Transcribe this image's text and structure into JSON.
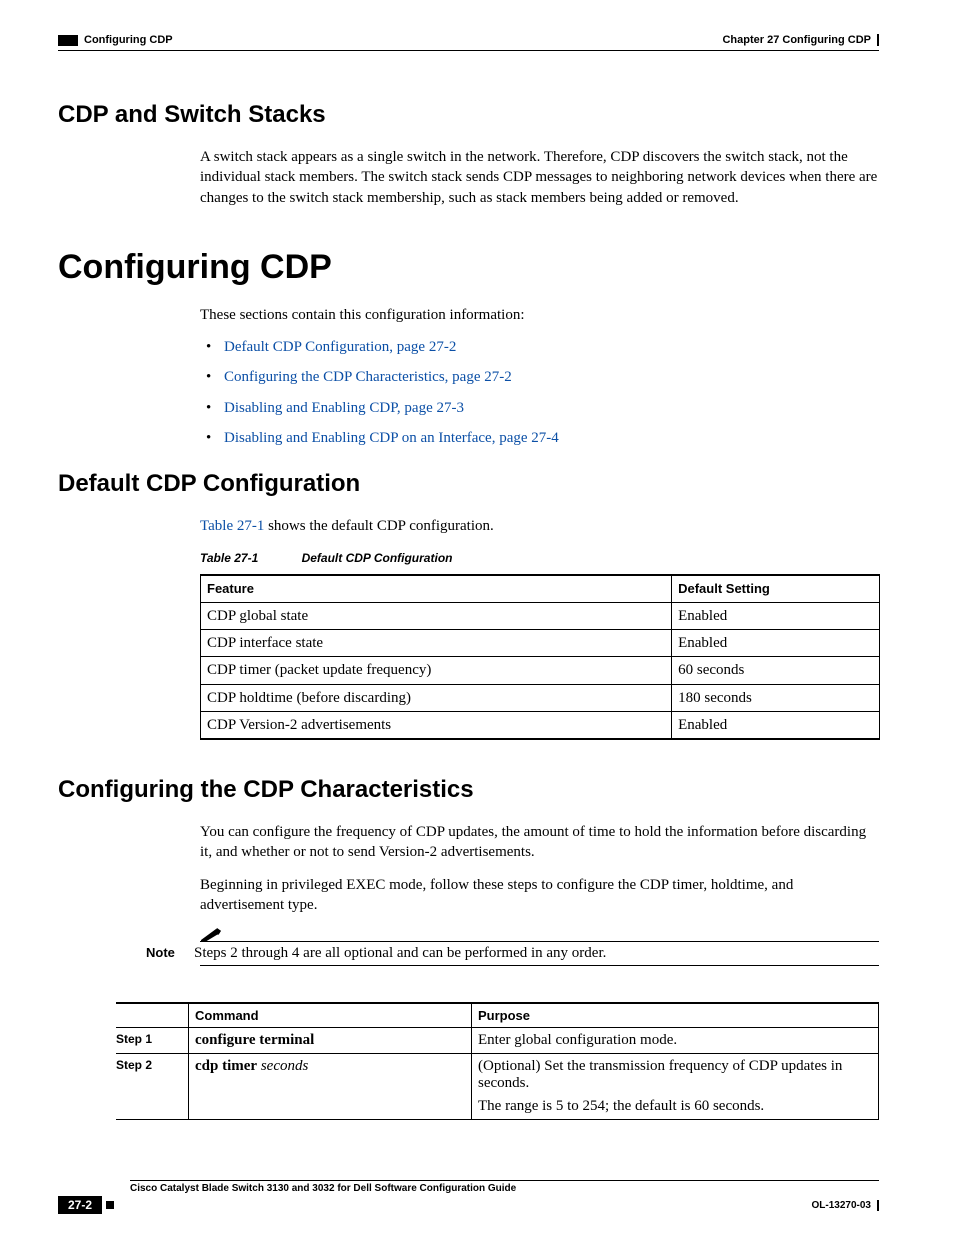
{
  "header": {
    "chapter_label": "Chapter 27    Configuring CDP",
    "section_label": "Configuring CDP"
  },
  "section1": {
    "title": "CDP and Switch Stacks",
    "body": "A switch stack appears as a single switch in the network. Therefore, CDP discovers the switch stack, not the individual stack members. The switch stack sends CDP messages to neighboring network devices when there are changes to the switch stack membership, such as stack members being added or removed."
  },
  "main_heading": "Configuring CDP",
  "intro_p": "These sections contain this configuration information:",
  "links": [
    "Default CDP Configuration, page 27-2",
    "Configuring the CDP Characteristics, page 27-2",
    "Disabling and Enabling CDP, page 27-3",
    "Disabling and Enabling CDP on an Interface, page 27-4"
  ],
  "section2": {
    "title": "Default CDP Configuration",
    "intro_prefix_link": "Table 27-1",
    "intro_suffix": " shows the default CDP configuration.",
    "table_caption_label": "Table 27-1",
    "table_caption_title": "Default CDP Configuration",
    "table_headers": [
      "Feature",
      "Default Setting"
    ],
    "table_rows": [
      [
        "CDP global state",
        "Enabled"
      ],
      [
        "CDP interface state",
        "Enabled"
      ],
      [
        "CDP timer (packet update frequency)",
        "60 seconds"
      ],
      [
        "CDP holdtime (before discarding)",
        "180 seconds"
      ],
      [
        "CDP Version-2 advertisements",
        "Enabled"
      ]
    ]
  },
  "section3": {
    "title": "Configuring the CDP Characteristics",
    "p1": "You can configure the frequency of CDP updates, the amount of time to hold the information before discarding it, and whether or not to send Version-2 advertisements.",
    "p2": "Beginning in privileged EXEC mode, follow these steps to configure the CDP timer, holdtime, and advertisement type.",
    "note_label": "Note",
    "note_text": "Steps 2 through 4 are all optional and can be performed in any order.",
    "cmd_headers": [
      "",
      "Command",
      "Purpose"
    ],
    "cmd_rows": [
      {
        "step": "Step 1",
        "cmd_bold": "configure terminal",
        "cmd_italic": "",
        "purpose": "Enter global configuration mode."
      },
      {
        "step": "Step 2",
        "cmd_bold": "cdp timer",
        "cmd_italic": "seconds",
        "purpose": "(Optional) Set the transmission frequency of CDP updates in seconds.",
        "purpose2": "The range is 5 to 254; the default is 60 seconds."
      }
    ]
  },
  "footer": {
    "doc_title": "Cisco Catalyst Blade Switch 3130 and 3032 for Dell Software Configuration Guide",
    "page_num": "27-2",
    "doc_id": "OL-13270-03"
  }
}
